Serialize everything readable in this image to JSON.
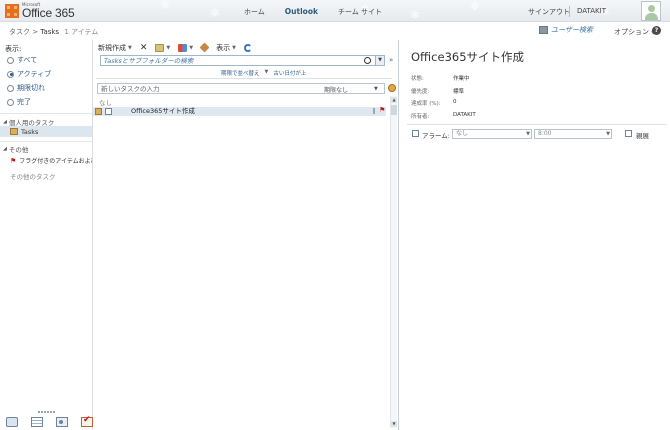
{
  "header": {
    "logo_small": "Microsoft",
    "logo_main": "Office 365",
    "nav": [
      "ホーム",
      "Outlook",
      "チーム サイト"
    ],
    "signout": "サインアウト",
    "username": "DATAKIT"
  },
  "subheader": {
    "breadcrumb_root": "タスク",
    "breadcrumb_current": "Tasks",
    "item_count": "1 アイテム",
    "user_search": "ユーザー検索",
    "options": "オプション",
    "help": "?"
  },
  "leftnav": {
    "show_label": "表示:",
    "filters": [
      {
        "label": "すべて",
        "selected": false
      },
      {
        "label": "アクティブ",
        "selected": true
      },
      {
        "label": "期限切れ",
        "selected": false
      },
      {
        "label": "完了",
        "selected": false
      }
    ],
    "personal_group": "個人用のタスク",
    "tasks_folder": "Tasks",
    "other_group": "その他",
    "flagged_item": "フラグ付きのアイテムおよびタスク",
    "other_tasks": "その他のタスク"
  },
  "toolbar": {
    "new_label": "新規作成",
    "view_label": "表示"
  },
  "search": {
    "placeholder": "Tasksとサブフォルダーの検索"
  },
  "sort": {
    "order_label": "期限で並べ替え",
    "direction_label": "古い日付が上"
  },
  "newtask": {
    "placeholder": "新しいタスクの入力",
    "due_label": "期限なし"
  },
  "list": {
    "group_header": "なし",
    "rows": [
      {
        "subject": "Office365サイト作成",
        "flagged": true
      }
    ]
  },
  "detail": {
    "title": "Office365サイト作成",
    "fields": [
      {
        "label": "状態:",
        "value": "作業中"
      },
      {
        "label": "優先度:",
        "value": "標準"
      },
      {
        "label": "達成率 (%):",
        "value": "0"
      },
      {
        "label": "所有者:",
        "value": "DATAKIT"
      }
    ],
    "alarm_label": "アラーム:",
    "alarm_date": "なし",
    "alarm_time": "8:00",
    "private_label": "親展"
  }
}
